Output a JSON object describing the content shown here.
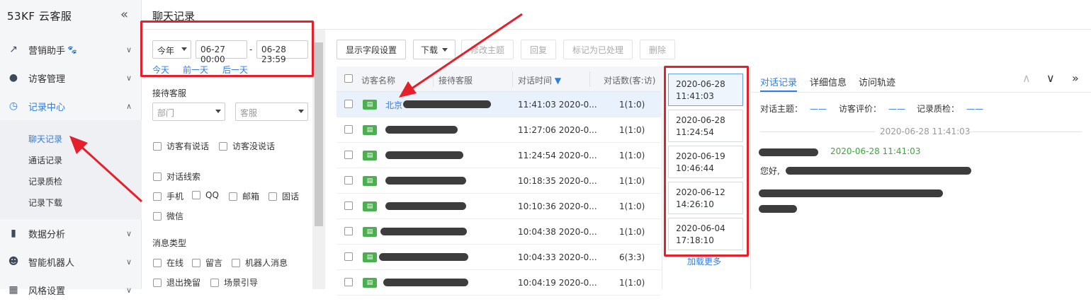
{
  "brand": "53KF 云客服",
  "page_title": "聊天记录",
  "sidebar": {
    "items": [
      {
        "label": "营销助手",
        "extra": "🐾",
        "icon": "trend-up-icon"
      },
      {
        "label": "访客管理",
        "icon": "user-icon"
      },
      {
        "label": "记录中心",
        "icon": "clock-icon"
      },
      {
        "label": "数据分析",
        "icon": "bar-chart-icon"
      },
      {
        "label": "智能机器人",
        "icon": "robot-icon"
      },
      {
        "label": "风格设置",
        "icon": "style-icon"
      }
    ],
    "sub_items": [
      "聊天记录",
      "通话记录",
      "记录质检",
      "记录下载"
    ]
  },
  "filter": {
    "period": "今年",
    "date_from": "06-27 00:00",
    "date_sep": "-",
    "date_to": "06-28 23:59",
    "quick_links": [
      "今天",
      "前一天",
      "后一天"
    ],
    "reception_label": "接待客服",
    "dept_placeholder": "部门",
    "agent_placeholder": "客服",
    "speak_options": [
      "访客有说话",
      "访客没说话"
    ],
    "clue_label": "对话线索",
    "clue_options": [
      "手机",
      "QQ",
      "邮箱",
      "固话",
      "微信"
    ],
    "msgtype_label": "消息类型",
    "msgtype_options": [
      "在线",
      "留言",
      "机器人消息",
      "退出挽留",
      "场景引导"
    ]
  },
  "toolbar": {
    "field_settings": "显示字段设置",
    "download": "下载",
    "edit_topic": "修改主题",
    "reply": "回复",
    "mark_done": "标记为已处理",
    "delete": "删除"
  },
  "table": {
    "headers": [
      "访客名称",
      "接待客服",
      "对话时间",
      "对话数(客:访)"
    ],
    "sort_indicator": "▼",
    "rows": [
      {
        "visitor": "北京",
        "time": "11:41:03 2020-0...",
        "count": "1(1:0)"
      },
      {
        "visitor": "",
        "time": "11:27:06 2020-0...",
        "count": "1(1:0)"
      },
      {
        "visitor": "",
        "time": "11:24:54 2020-0...",
        "count": "1(1:0)"
      },
      {
        "visitor": "",
        "time": "10:18:35 2020-0...",
        "count": "1(1:0)"
      },
      {
        "visitor": "",
        "time": "10:10:36 2020-0...",
        "count": "1(1:0)"
      },
      {
        "visitor": "",
        "time": "10:04:38 2020-0...",
        "count": "1(1:0)"
      },
      {
        "visitor": "",
        "time": "10:04:33 2020-0...",
        "count": "6(3:3)"
      },
      {
        "visitor": "",
        "time": "10:04:19 2020-0...",
        "count": "1(1:0)"
      }
    ]
  },
  "sessions": {
    "cards": [
      {
        "date": "2020-06-28",
        "time": "11:41:03"
      },
      {
        "date": "2020-06-28",
        "time": "11:24:54"
      },
      {
        "date": "2020-06-19",
        "time": "10:46:44"
      },
      {
        "date": "2020-06-12",
        "time": "14:26:10"
      },
      {
        "date": "2020-06-04",
        "time": "17:18:10"
      }
    ],
    "load_more": "加载更多"
  },
  "detail": {
    "tabs": [
      "对话记录",
      "详细信息",
      "访问轨迹"
    ],
    "topic_label": "对话主题：",
    "topic_value": "——",
    "rating_label": "访客评价：",
    "rating_value": "——",
    "qc_label": "记录质检：",
    "qc_value": "——",
    "divider_time": "2020-06-28 11:41:03",
    "msg_time": "2020-06-28 11:41:03",
    "greeting": "您好,"
  },
  "colors": {
    "accent": "#2f7de1",
    "annotation": "#e5202a",
    "visitor_badge": "#4caf50"
  }
}
